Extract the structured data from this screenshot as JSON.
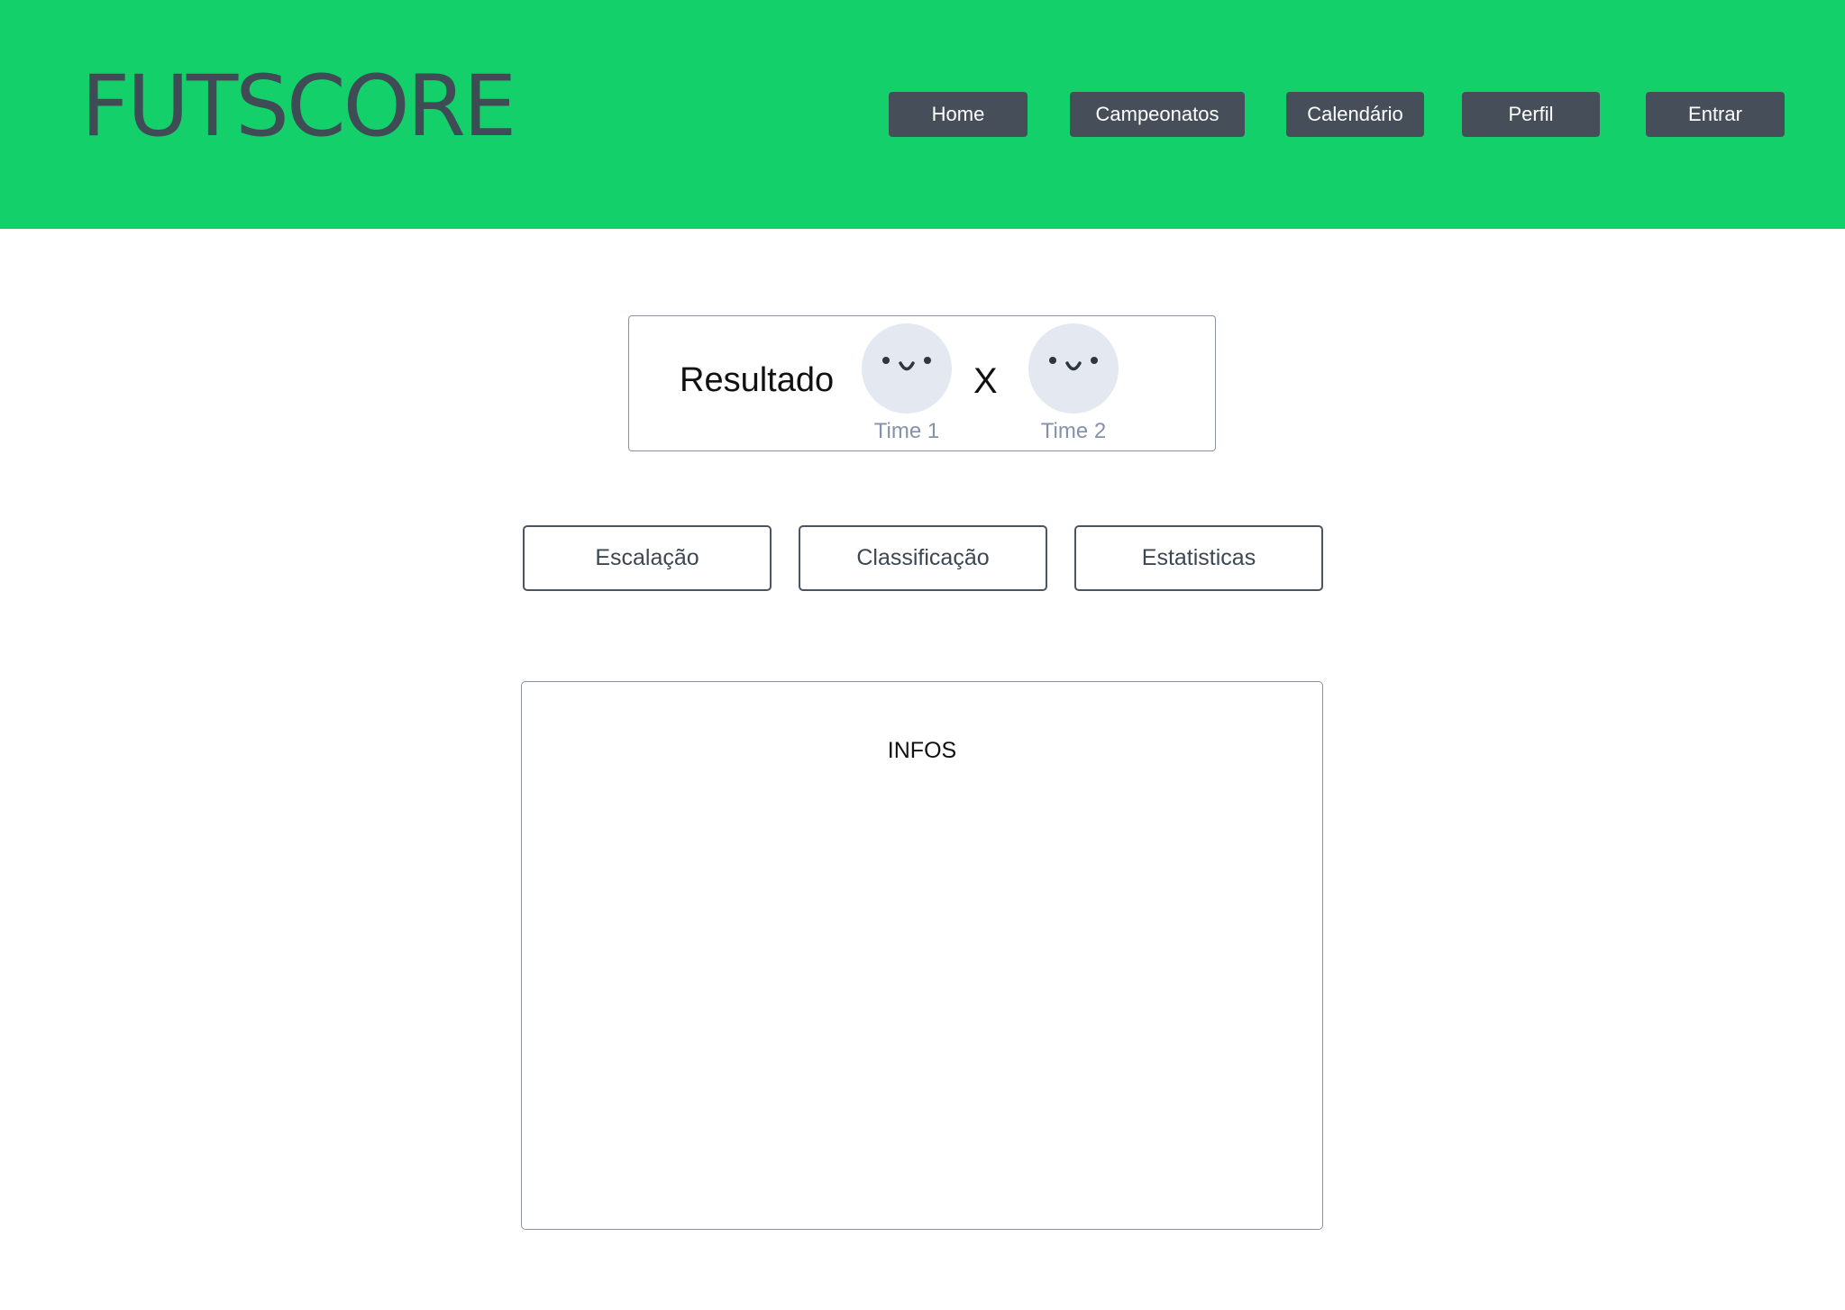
{
  "header": {
    "logo": "FUTSCORE",
    "background_color": "#14d06a",
    "nav": {
      "home": "Home",
      "campeonatos": "Campeonatos",
      "calendario": "Calendário",
      "perfil": "Perfil",
      "entrar": "Entrar"
    }
  },
  "result": {
    "label": "Resultado",
    "versus": "X",
    "team1": {
      "name": "Time 1",
      "icon": "smiley-avatar-icon"
    },
    "team2": {
      "name": "Time 2",
      "icon": "smiley-avatar-icon"
    }
  },
  "tabs": {
    "escalacao": "Escalação",
    "classificacao": "Classificação",
    "estatisticas": "Estatisticas"
  },
  "infos": {
    "title": "INFOS"
  }
}
